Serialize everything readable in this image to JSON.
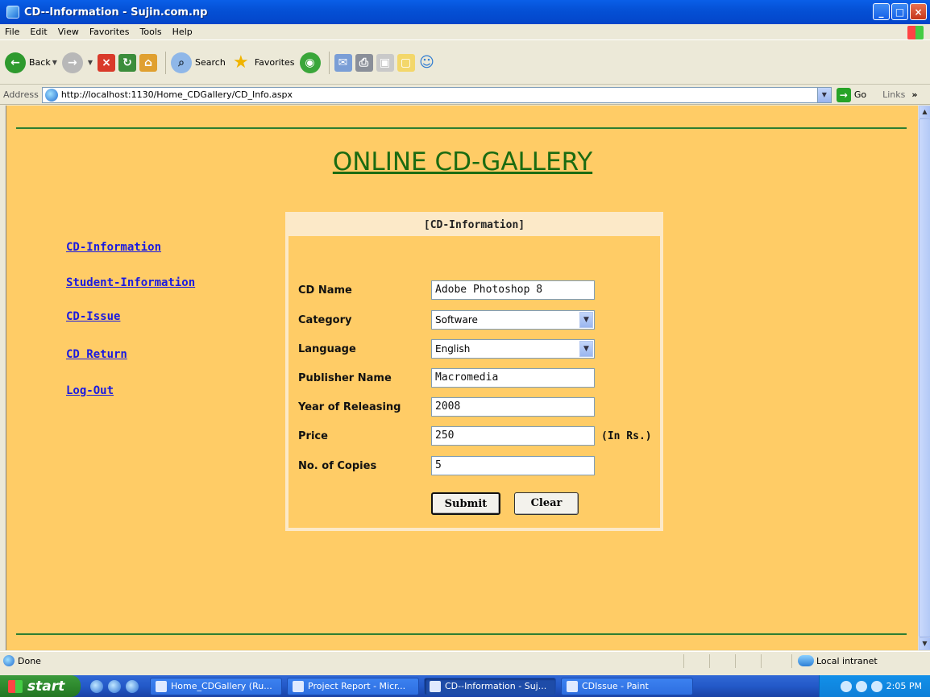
{
  "window": {
    "title": "CD--Information - Sujin.com.np",
    "controls": [
      "_",
      "□",
      "×"
    ]
  },
  "menu": [
    "File",
    "Edit",
    "View",
    "Favorites",
    "Tools",
    "Help"
  ],
  "toolbar": {
    "back": "Back",
    "search": "Search",
    "favorites": "Favorites"
  },
  "address": {
    "label": "Address",
    "url": "http://localhost:1130/Home_CDGallery/CD_Info.aspx",
    "go": "Go",
    "links": "Links",
    "more": "»"
  },
  "page": {
    "heading": "ONLINE CD-GALLERY",
    "nav": [
      {
        "label": "CD-Information"
      },
      {
        "label": "Student-Information"
      },
      {
        "label": "CD-Issue"
      },
      {
        "label": "CD  Return"
      },
      {
        "label": "Log-Out"
      }
    ],
    "form": {
      "title": "[CD-Information]",
      "fields": {
        "cd_name": {
          "label": "CD Name",
          "value": "Adobe Photoshop 8"
        },
        "category": {
          "label": "Category",
          "value": "Software"
        },
        "language": {
          "label": "Language",
          "value": "English"
        },
        "publisher": {
          "label": "Publisher Name",
          "value": "Macromedia"
        },
        "year": {
          "label": "Year of Releasing",
          "value": "2008"
        },
        "price": {
          "label": "Price",
          "value": "250",
          "unit": "(In Rs.)"
        },
        "copies": {
          "label": "No. of Copies",
          "value": "5"
        }
      },
      "submit": "Submit",
      "clear": "Clear"
    }
  },
  "status": {
    "text": "Done",
    "zone": "Local intranet"
  },
  "taskbar": {
    "start": "start",
    "tasks": [
      {
        "label": "Home_CDGallery (Ru...",
        "active": false
      },
      {
        "label": "Project Report - Micr...",
        "active": false
      },
      {
        "label": "CD--Information - Suj...",
        "active": true
      },
      {
        "label": "CDIssue - Paint",
        "active": false
      }
    ],
    "clock": "2:05 PM"
  }
}
